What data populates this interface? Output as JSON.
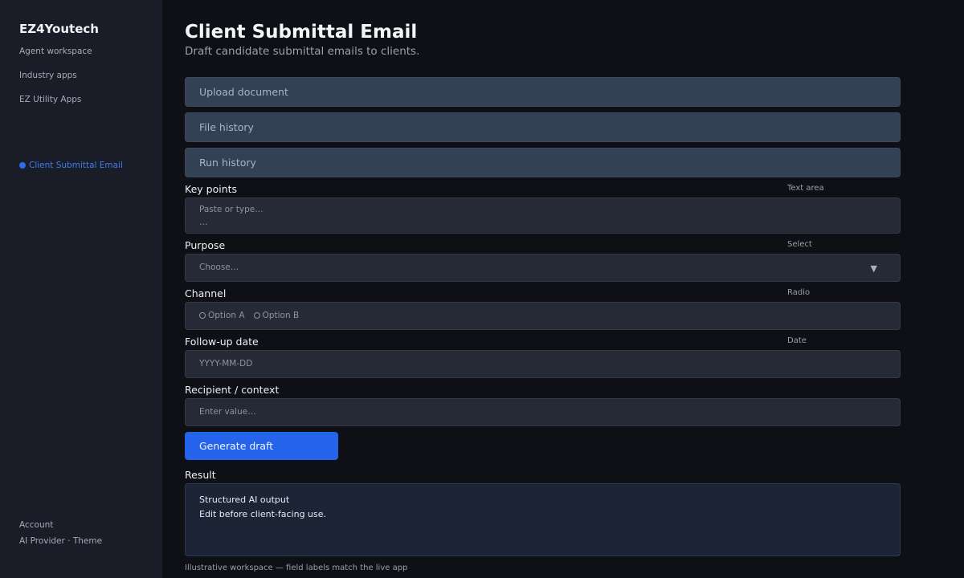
{
  "sidebar": {
    "brand": "EZ4Youtech",
    "items": [
      {
        "label": "Agent workspace"
      },
      {
        "label": "Industry apps"
      },
      {
        "label": "EZ Utility Apps"
      }
    ],
    "active_item": "Client Submittal Email",
    "footer": {
      "account": "Account",
      "provider_theme": "AI Provider · Theme"
    }
  },
  "header": {
    "title": "Client Submittal Email",
    "subtitle": "Draft candidate submittal emails to clients."
  },
  "panels": [
    {
      "label": "Upload document"
    },
    {
      "label": "File history"
    },
    {
      "label": "Run history"
    }
  ],
  "fields": {
    "key_points": {
      "label": "Key points",
      "type": "Text area",
      "placeholder": "Paste or type…",
      "continuation": "…"
    },
    "purpose": {
      "label": "Purpose",
      "type": "Select",
      "placeholder": "Choose…"
    },
    "channel": {
      "label": "Channel",
      "type": "Radio",
      "options": [
        "Option A",
        "Option B"
      ]
    },
    "follow_up": {
      "label": "Follow-up date",
      "type": "Date",
      "placeholder": "YYYY-MM-DD"
    },
    "recipient": {
      "label": "Recipient / context",
      "placeholder": "Enter value…"
    }
  },
  "actions": {
    "generate": "Generate draft"
  },
  "result": {
    "label": "Result",
    "lines": [
      "Structured AI output",
      "Edit before client-facing use."
    ]
  },
  "footnote": "Illustrative workspace — field labels match the live app",
  "colors": {
    "accent": "#2563eb",
    "sidebar_bg": "#1a1c27",
    "page_bg": "#0e1016",
    "panel_bg": "#334155"
  },
  "icons": {
    "select_caret": "chevron-down-icon",
    "active_marker": "dot-icon"
  }
}
